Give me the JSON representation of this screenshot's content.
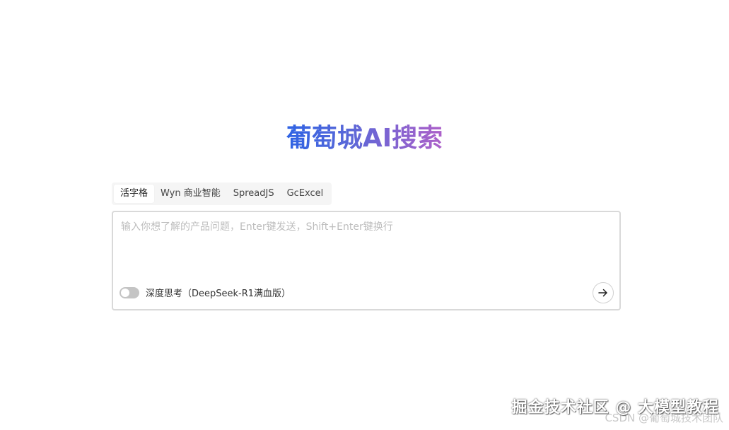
{
  "title": "葡萄城AI搜索",
  "tabs": [
    {
      "label": "活字格",
      "active": true
    },
    {
      "label": "Wyn 商业智能",
      "active": false
    },
    {
      "label": "SpreadJS",
      "active": false
    },
    {
      "label": "GcExcel",
      "active": false
    }
  ],
  "search": {
    "placeholder": "输入你想了解的产品问题，Enter键发送，Shift+Enter键换行",
    "value": ""
  },
  "deep_think": {
    "label": "深度思考（DeepSeek-R1满血版）",
    "enabled": false
  },
  "send_icon": "arrow-right-icon",
  "watermark": {
    "main": "掘金技术社区 @ 大模型教程",
    "sub": "CSDN @葡萄城技术团队"
  },
  "colors": {
    "title_gradient_start": "#2e63e4",
    "title_gradient_end": "#ad60c9",
    "border": "#d9d9d9",
    "tab_bar_bg": "#f5f5f5"
  }
}
